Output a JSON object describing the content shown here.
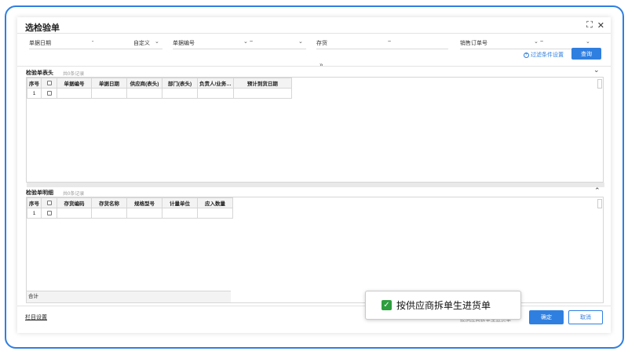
{
  "dialog": {
    "title": "选检验单",
    "expand_icon": "expand-icon",
    "close_icon": "close-icon"
  },
  "filters": {
    "doc_date": {
      "label": "单据日期",
      "separator": "-",
      "range_value": "自定义"
    },
    "doc_no": {
      "label": "单据编号",
      "separator": "~"
    },
    "inventory": {
      "label": "存货",
      "separator": "~"
    },
    "sales_order": {
      "label": "销售订单号",
      "separator": "~"
    }
  },
  "toolbar": {
    "filter_settings": "过滤条件设置",
    "query": "查询"
  },
  "header_section": {
    "title": "检验单表头",
    "count": "共0条记录",
    "columns": [
      "序号",
      "",
      "单据编号",
      "单据日期",
      "供应商(表头)",
      "部门(表头)",
      "负责人/业务…",
      "预计到货日期"
    ],
    "rows": [
      {
        "index": "1"
      }
    ]
  },
  "detail_section": {
    "title": "检验单明细",
    "count": "共0条记录",
    "columns": [
      "序号",
      "",
      "存货编码",
      "存货名称",
      "规格型号",
      "计量单位",
      "应入数量"
    ],
    "rows": [
      {
        "index": "1"
      }
    ],
    "total_label": "合计"
  },
  "footer": {
    "column_settings": "栏目设置",
    "ghost_option": "按供应商拆单生进货单",
    "confirm": "确定",
    "cancel": "取消"
  },
  "popover": {
    "label": "按供应商拆单生进货单",
    "checked": true
  },
  "colors": {
    "accent": "#2f7fe0",
    "check": "#2e9e3e"
  }
}
